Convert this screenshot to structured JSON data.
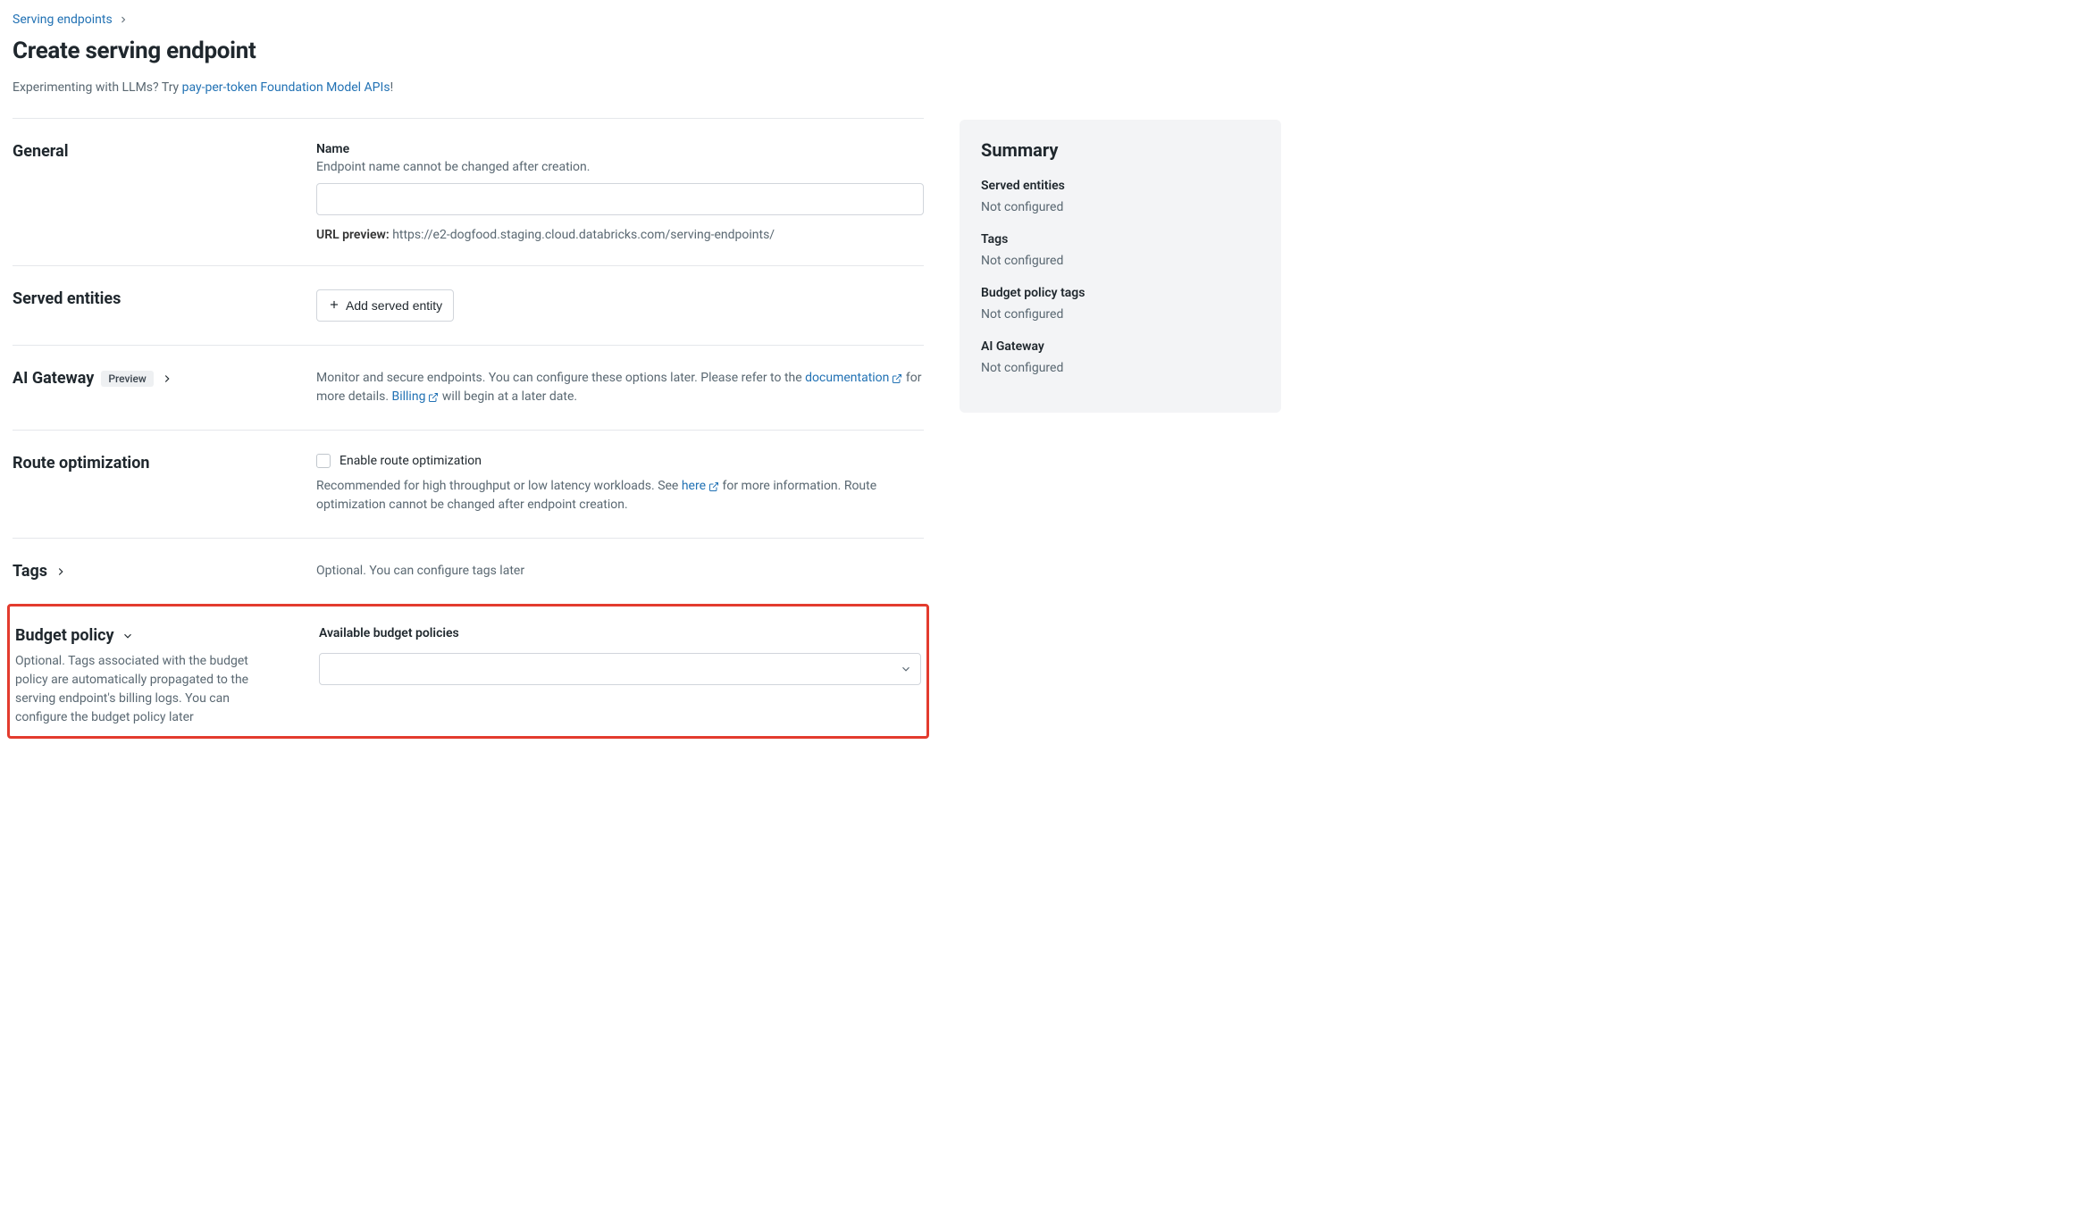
{
  "breadcrumb": {
    "parent": "Serving endpoints"
  },
  "page_title": "Create serving endpoint",
  "hint_prefix": "Experimenting with LLMs? Try ",
  "hint_link": "pay-per-token Foundation Model APIs",
  "hint_suffix": "!",
  "general": {
    "title": "General",
    "name_label": "Name",
    "name_sub": "Endpoint name cannot be changed after creation.",
    "name_value": "",
    "url_preview_label": "URL preview:",
    "url_preview_value": "https://e2-dogfood.staging.cloud.databricks.com/serving-endpoints/"
  },
  "served": {
    "title": "Served entities",
    "add_button": "Add served entity"
  },
  "ai_gateway": {
    "title": "AI Gateway",
    "badge": "Preview",
    "text_before": "Monitor and secure endpoints. You can configure these options later. Please refer to the ",
    "doc_link": "documentation",
    "text_mid": " for more details. ",
    "billing_link": "Billing",
    "text_after": " will begin at a later date."
  },
  "route_opt": {
    "title": "Route optimization",
    "checkbox_label": "Enable route optimization",
    "text_before": "Recommended for high throughput or low latency workloads. See ",
    "here_link": "here",
    "text_after": " for more information. Route optimization cannot be changed after endpoint creation."
  },
  "tags": {
    "title": "Tags",
    "desc": "Optional. You can configure tags later"
  },
  "budget": {
    "title": "Budget policy",
    "desc": "Optional. Tags associated with the budget policy are automatically propagated to the serving endpoint's billing logs. You can configure the budget policy later",
    "field_label": "Available budget policies",
    "value": ""
  },
  "summary": {
    "title": "Summary",
    "items": [
      {
        "title": "Served entities",
        "value": "Not configured"
      },
      {
        "title": "Tags",
        "value": "Not configured"
      },
      {
        "title": "Budget policy tags",
        "value": "Not configured"
      },
      {
        "title": "AI Gateway",
        "value": "Not configured"
      }
    ]
  }
}
